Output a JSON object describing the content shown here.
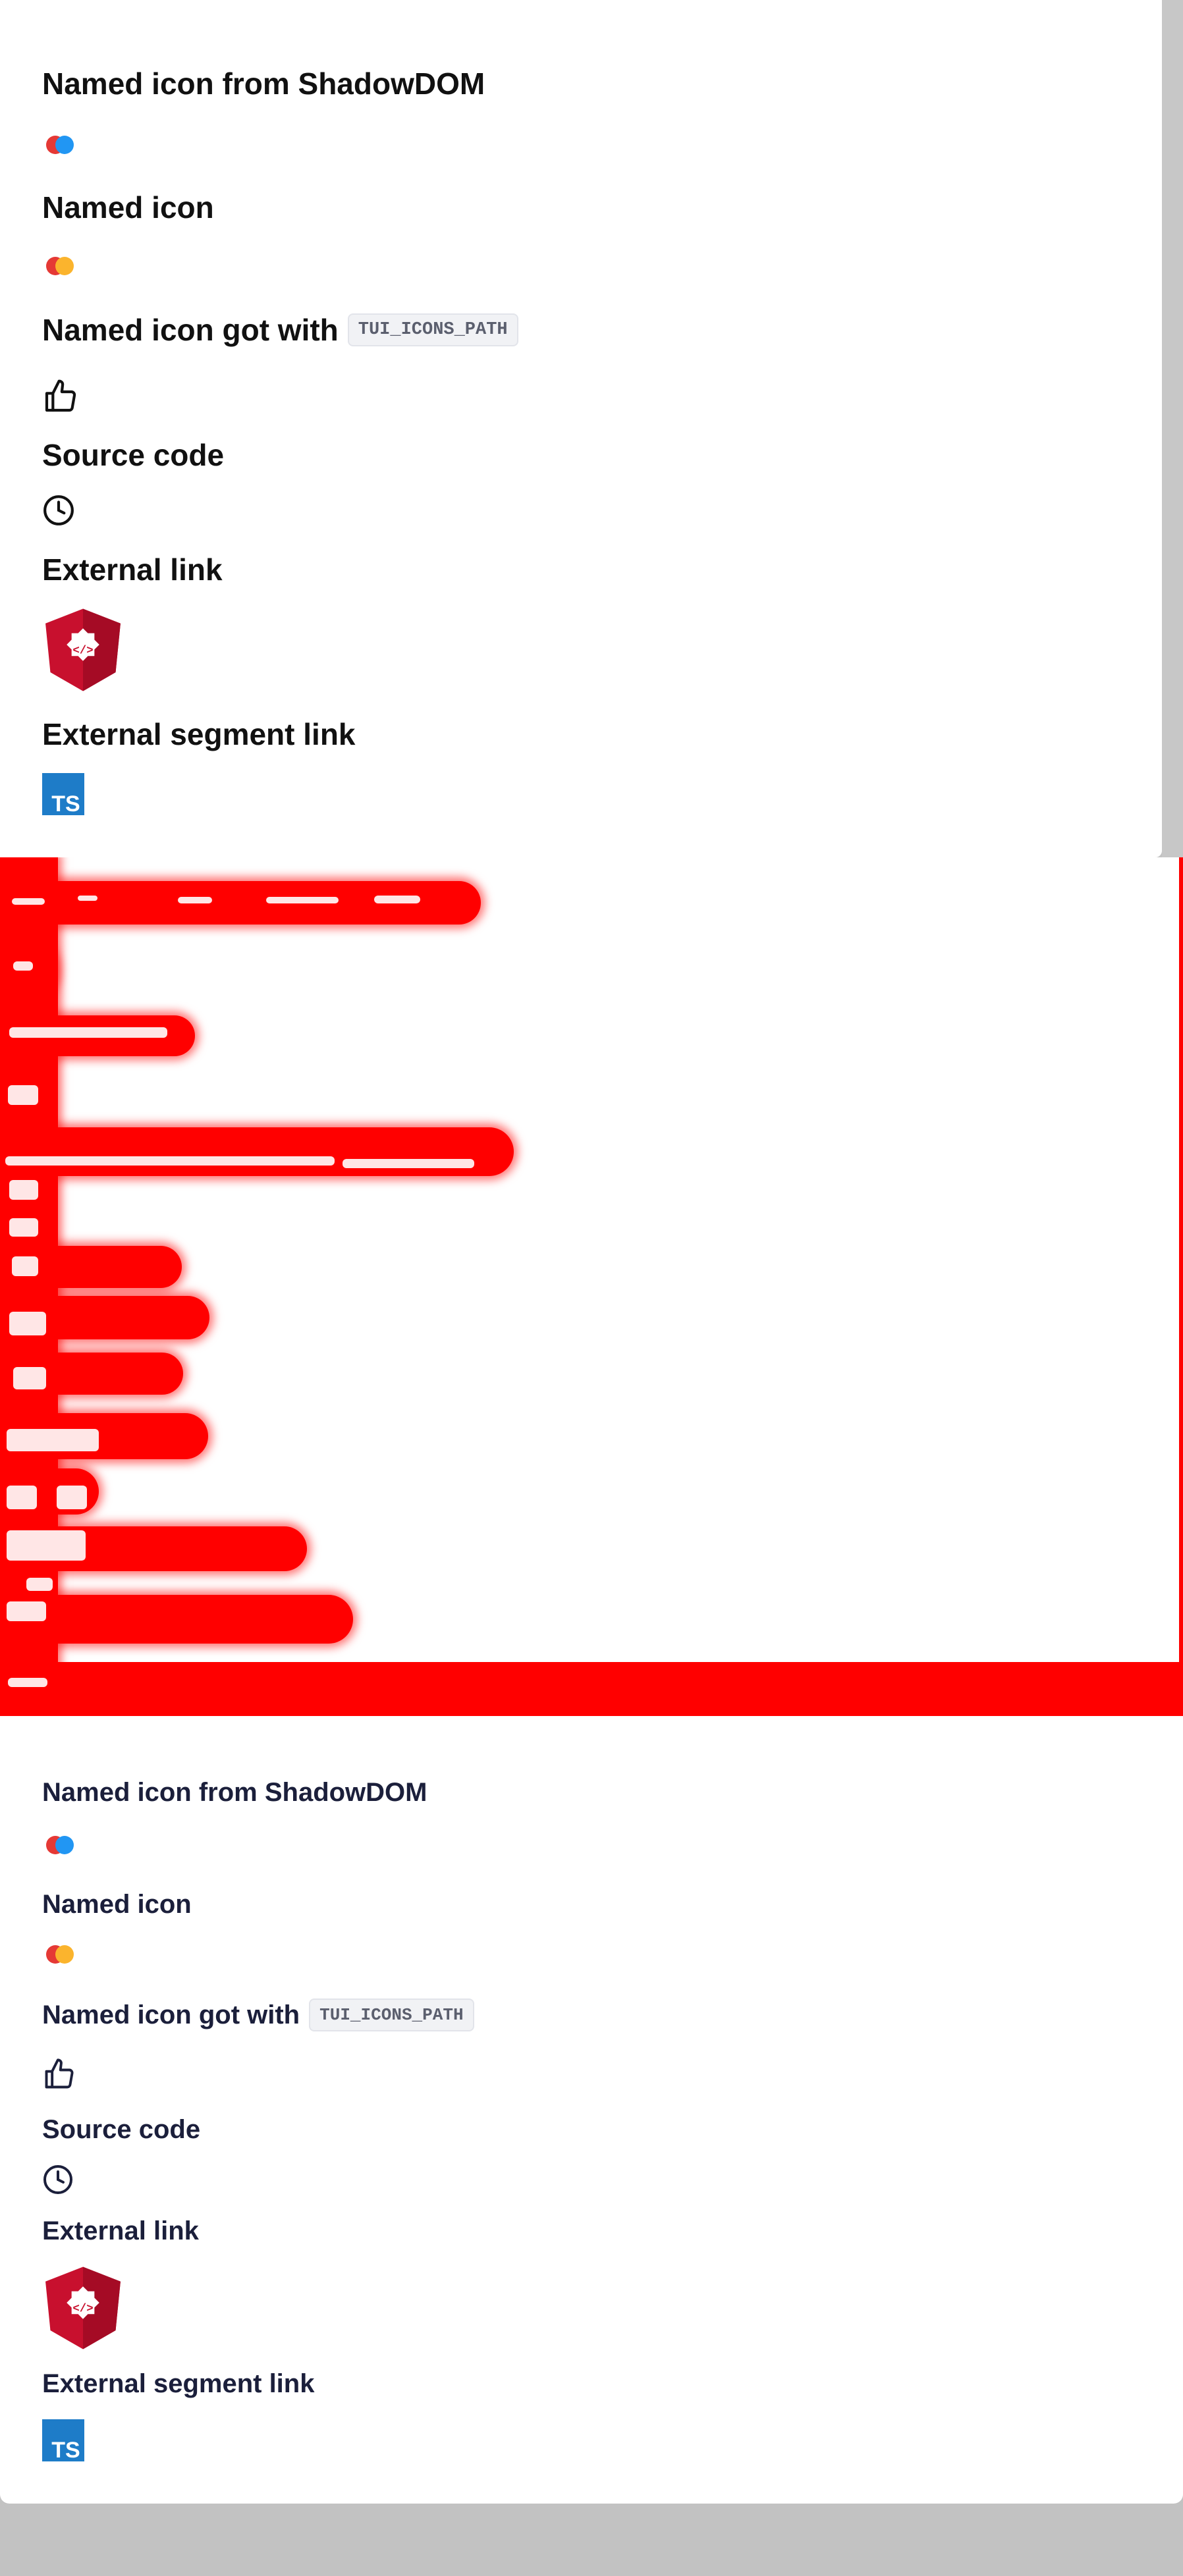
{
  "sections": {
    "shadow": {
      "heading": "Named icon from ShadowDOM",
      "icon": "two-circles-red-blue-icon"
    },
    "named": {
      "heading": "Named icon",
      "icon": "two-circles-red-yellow-icon"
    },
    "path": {
      "heading": "Named icon got with",
      "code": "TUI_ICONS_PATH",
      "icon": "thumbs-up-icon"
    },
    "source": {
      "heading": "Source code",
      "icon": "clock-icon"
    },
    "external": {
      "heading": "External link",
      "icon": "angular-shield-icon"
    },
    "segment": {
      "heading": "External segment link",
      "icon": "typescript-icon",
      "icon_text": "TS"
    }
  },
  "colors": {
    "angular_red": "#c8102e",
    "typescript_blue": "#1e7cc8",
    "circle_red": "#e53935",
    "circle_blue": "#2196f3",
    "circle_yellow": "#fbb42d",
    "redaction": "#ff0000",
    "scrollbar": "#c7c7c7"
  }
}
